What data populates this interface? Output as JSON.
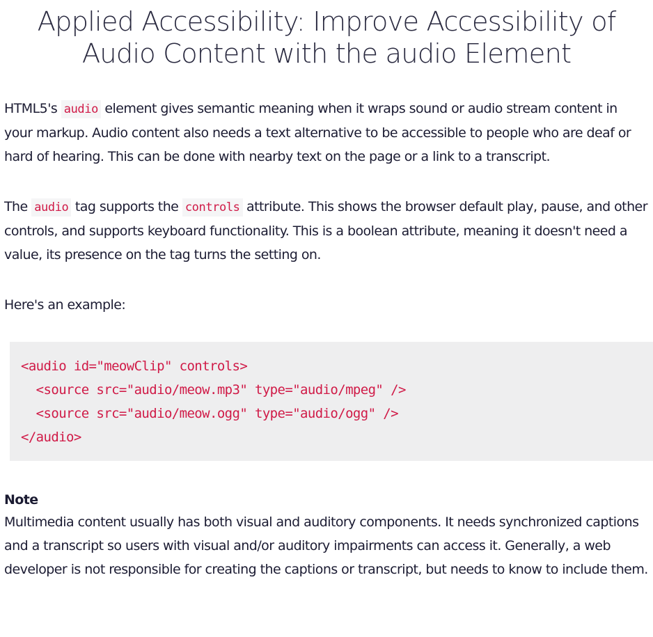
{
  "title": "Applied Accessibility: Improve Accessibility of Audio Content with the audio Element",
  "paragraph1": {
    "before": "HTML5's ",
    "code": "audio",
    "after": " element gives semantic meaning when it wraps sound or audio stream content in your markup. Audio content also needs a text alternative to be accessible to people who are deaf or hard of hearing. This can be done with nearby text on the page or a link to a transcript."
  },
  "paragraph2": {
    "part1": "The ",
    "code1": "audio",
    "part2": " tag supports the ",
    "code2": "controls",
    "part3": " attribute. This shows the browser default play, pause, and other controls, and supports keyboard functionality. This is a boolean attribute, meaning it doesn't need a value, its presence on the tag turns the setting on."
  },
  "paragraph3": "Here's an example:",
  "code_block": {
    "lines": [
      "<audio id=\"meowClip\" controls>",
      "  <source src=\"audio/meow.mp3\" type=\"audio/mpeg\" />",
      "  <source src=\"audio/meow.ogg\" type=\"audio/ogg\" />",
      "</audio>"
    ]
  },
  "note": {
    "label": "Note",
    "text": "Multimedia content usually has both visual and auditory components. It needs synchronized captions and a transcript so users with visual and/or auditory impairments can access it. Generally, a web developer is not responsible for creating the captions or transcript, but needs to know to include them."
  }
}
